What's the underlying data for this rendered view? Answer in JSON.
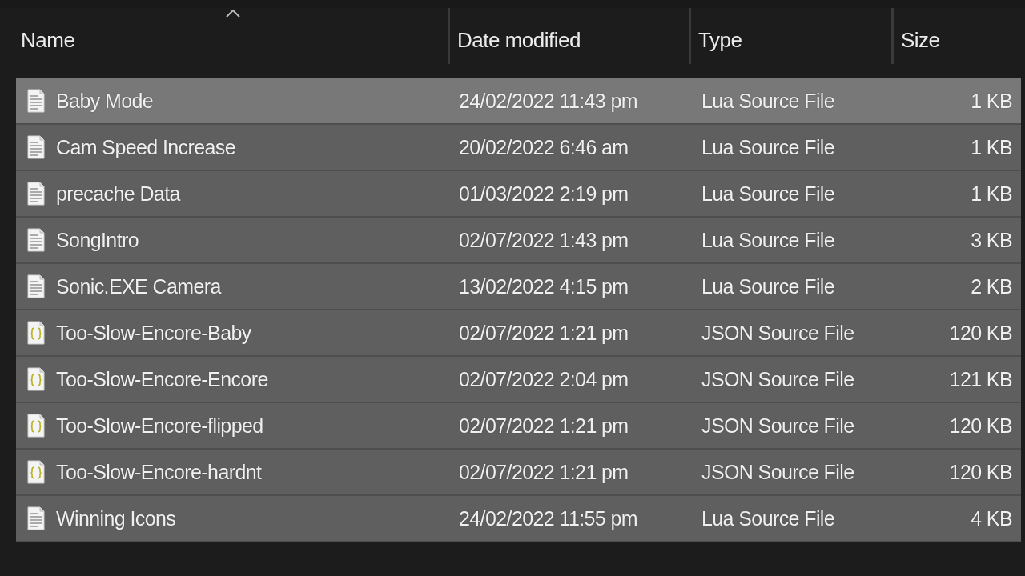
{
  "columns": [
    {
      "label": "Name",
      "sorted": true
    },
    {
      "label": "Date modified",
      "sorted": false
    },
    {
      "label": "Type",
      "sorted": false
    },
    {
      "label": "Size",
      "sorted": false
    }
  ],
  "rows": [
    {
      "kind": "lua",
      "name": "Baby Mode",
      "date": "24/02/2022 11:43 pm",
      "type": "Lua Source File",
      "size": "1 KB",
      "selected": true,
      "highlighted": true
    },
    {
      "kind": "lua",
      "name": "Cam Speed Increase",
      "date": "20/02/2022 6:46 am",
      "type": "Lua Source File",
      "size": "1 KB",
      "selected": true,
      "highlighted": false
    },
    {
      "kind": "lua",
      "name": "precache Data",
      "date": "01/03/2022 2:19 pm",
      "type": "Lua Source File",
      "size": "1 KB",
      "selected": true,
      "highlighted": false
    },
    {
      "kind": "lua",
      "name": "SongIntro",
      "date": "02/07/2022 1:43 pm",
      "type": "Lua Source File",
      "size": "3 KB",
      "selected": true,
      "highlighted": false
    },
    {
      "kind": "lua",
      "name": "Sonic.EXE Camera",
      "date": "13/02/2022 4:15 pm",
      "type": "Lua Source File",
      "size": "2 KB",
      "selected": true,
      "highlighted": false
    },
    {
      "kind": "json",
      "name": "Too-Slow-Encore-Baby",
      "date": "02/07/2022 1:21 pm",
      "type": "JSON Source File",
      "size": "120 KB",
      "selected": true,
      "highlighted": false
    },
    {
      "kind": "json",
      "name": "Too-Slow-Encore-Encore",
      "date": "02/07/2022 2:04 pm",
      "type": "JSON Source File",
      "size": "121 KB",
      "selected": true,
      "highlighted": false
    },
    {
      "kind": "json",
      "name": "Too-Slow-Encore-flipped",
      "date": "02/07/2022 1:21 pm",
      "type": "JSON Source File",
      "size": "120 KB",
      "selected": true,
      "highlighted": false
    },
    {
      "kind": "json",
      "name": "Too-Slow-Encore-hardnt",
      "date": "02/07/2022 1:21 pm",
      "type": "JSON Source File",
      "size": "120 KB",
      "selected": true,
      "highlighted": false
    },
    {
      "kind": "lua",
      "name": "Winning Icons",
      "date": "24/02/2022 11:55 pm",
      "type": "Lua Source File",
      "size": "4 KB",
      "selected": true,
      "highlighted": false
    }
  ]
}
